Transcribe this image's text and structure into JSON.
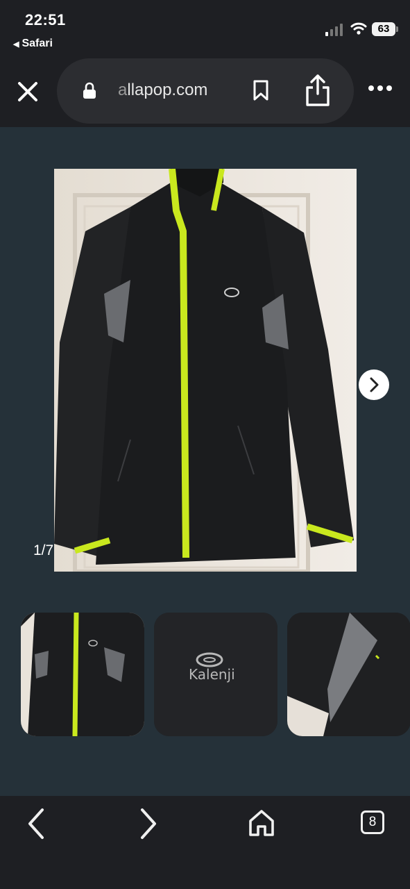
{
  "status_bar": {
    "time": "22:51",
    "back_app": "Safari",
    "battery": "63"
  },
  "browser": {
    "url_fade": "a",
    "url_main": "llapop.com",
    "tab_count": "8"
  },
  "gallery": {
    "counter": "1/7",
    "brand_logo_text": "Kalenji"
  },
  "colors": {
    "background": "#253139",
    "chrome": "#1e1f23",
    "jacket": "#1b1c1e",
    "accent": "#c9e81e"
  }
}
